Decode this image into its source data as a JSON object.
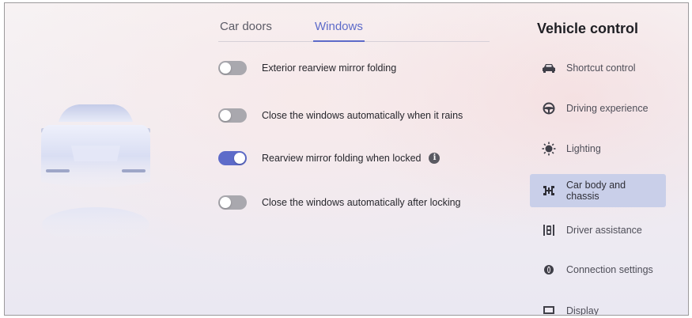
{
  "tabs": [
    {
      "label": "Car doors",
      "active": false
    },
    {
      "label": "Windows",
      "active": true
    }
  ],
  "settings": [
    {
      "label": "Exterior rearview mirror folding",
      "enabled": false
    },
    {
      "label": "Close the windows automatically when it rains",
      "enabled": false
    },
    {
      "label": "Rearview mirror folding when locked",
      "enabled": true,
      "info_icon": "info-icon"
    },
    {
      "label": "Close the windows automatically after locking",
      "enabled": false
    }
  ],
  "panel": {
    "title": "Vehicle control",
    "items": [
      {
        "label": "Shortcut control",
        "icon": "car-icon",
        "active": false
      },
      {
        "label": "Driving experience",
        "icon": "steering-wheel-icon",
        "active": false
      },
      {
        "label": "Lighting",
        "icon": "light-icon",
        "active": false
      },
      {
        "label": "Car body and chassis",
        "icon": "chassis-icon",
        "active": true
      },
      {
        "label": "Driver assistance",
        "icon": "driver-assistance-icon",
        "active": false
      },
      {
        "label": "Connection settings",
        "icon": "connection-icon",
        "active": false
      },
      {
        "label": "Display",
        "icon": "display-icon",
        "active": false
      }
    ]
  },
  "colors": {
    "accent": "#5d6bc9",
    "toggle_off": "#a9a8ae",
    "active_nav_bg": "#c9cfe9"
  }
}
